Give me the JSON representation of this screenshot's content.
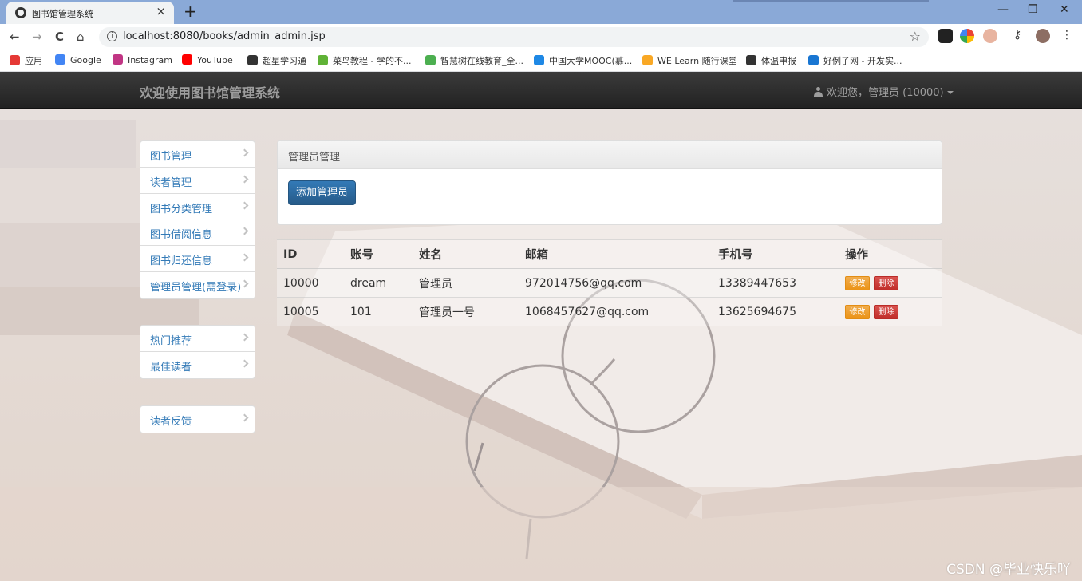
{
  "browser": {
    "tab_title": "图书馆管理系统",
    "tab_close": "×",
    "new_tab": "+",
    "url": "localhost:8080/books/admin_admin.jsp",
    "window_buttons": [
      "—",
      "❐",
      "✕"
    ],
    "nav_icons": [
      "←",
      "→",
      "C",
      "⌂"
    ],
    "bookmarks": [
      {
        "label": "应用",
        "color": "#e53935"
      },
      {
        "label": "Google",
        "color": "#4285f4"
      },
      {
        "label": "Instagram",
        "color": "#c13584"
      },
      {
        "label": "YouTube",
        "color": "#ff0000"
      },
      {
        "label": "超星学习通",
        "color": "#333333"
      },
      {
        "label": "菜鸟教程 - 学的不...",
        "color": "#5fb236"
      },
      {
        "label": "智慧树在线教育_全...",
        "color": "#4caf50"
      },
      {
        "label": "中国大学MOOC(慕...",
        "color": "#1e88e5"
      },
      {
        "label": "WE Learn 随行课堂",
        "color": "#f9a825"
      },
      {
        "label": "体温申报",
        "color": "#333333"
      },
      {
        "label": "好例子网 - 开发实...",
        "color": "#1976d2"
      }
    ]
  },
  "navbar": {
    "brand": "欢迎使用图书馆管理系统",
    "user": "欢迎您，管理员 (10000)"
  },
  "sidebar": {
    "group1": [
      "图书管理",
      "读者管理",
      "图书分类管理",
      "图书借阅信息",
      "图书归还信息",
      "管理员管理(需登录)"
    ],
    "group2": [
      "热门推荐",
      "最佳读者"
    ],
    "group3": [
      "读者反馈"
    ]
  },
  "panel": {
    "heading": "管理员管理",
    "add_button": "添加管理员"
  },
  "table": {
    "headers": [
      "ID",
      "账号",
      "姓名",
      "邮箱",
      "手机号",
      "操作"
    ],
    "rows": [
      [
        "10000",
        "dream",
        "管理员",
        "972014756@qq.com",
        "13389447653"
      ],
      [
        "10005",
        "101",
        "管理员一号",
        "1068457627@qq.com",
        "13625694675"
      ]
    ],
    "edit_label": "修改",
    "delete_label": "删除"
  },
  "watermark": "CSDN @毕业快乐吖"
}
